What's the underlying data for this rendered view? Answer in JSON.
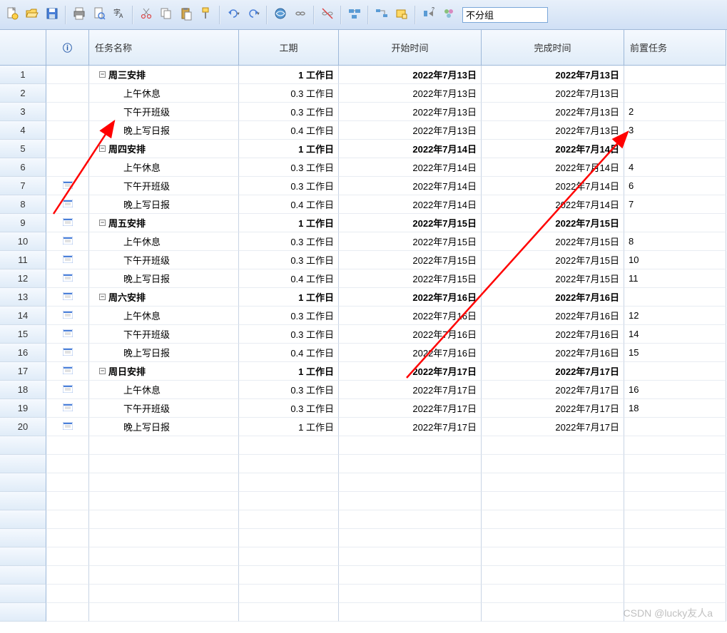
{
  "toolbar": {
    "group_input": "不分组",
    "icons": [
      "new-file-icon",
      "open-icon",
      "save-icon",
      "sep",
      "print-icon",
      "print-preview-icon",
      "spell-icon",
      "sep",
      "cut-icon",
      "copy-icon",
      "paste-icon",
      "format-painter-icon",
      "sep",
      "undo-icon",
      "redo-icon",
      "sep",
      "link-icon",
      "unlink-icon",
      "sep",
      "split-icon",
      "sep",
      "info-icon",
      "sep",
      "goto-icon",
      "note-icon",
      "sep",
      "zoom-icon",
      "group-icon"
    ]
  },
  "columns": {
    "info_header": "ⓘ",
    "name": "任务名称",
    "duration": "工期",
    "start": "开始时间",
    "finish": "完成时间",
    "predecessors": "前置任务"
  },
  "rows": [
    {
      "num": "1",
      "info": "",
      "level": 0,
      "summary": true,
      "name": "周三安排",
      "duration": "1 工作日",
      "start": "2022年7月13日",
      "finish": "2022年7月13日",
      "pred": ""
    },
    {
      "num": "2",
      "info": "",
      "level": 1,
      "summary": false,
      "name": "上午休息",
      "duration": "0.3 工作日",
      "start": "2022年7月13日",
      "finish": "2022年7月13日",
      "pred": ""
    },
    {
      "num": "3",
      "info": "",
      "level": 1,
      "summary": false,
      "name": "下午开班级",
      "duration": "0.3 工作日",
      "start": "2022年7月13日",
      "finish": "2022年7月13日",
      "pred": "2"
    },
    {
      "num": "4",
      "info": "",
      "level": 1,
      "summary": false,
      "name": "晚上写日报",
      "duration": "0.4 工作日",
      "start": "2022年7月13日",
      "finish": "2022年7月13日",
      "pred": "3"
    },
    {
      "num": "5",
      "info": "",
      "level": 0,
      "summary": true,
      "name": "周四安排",
      "duration": "1 工作日",
      "start": "2022年7月14日",
      "finish": "2022年7月14日",
      "pred": ""
    },
    {
      "num": "6",
      "info": "",
      "level": 1,
      "summary": false,
      "name": "上午休息",
      "duration": "0.3 工作日",
      "start": "2022年7月14日",
      "finish": "2022年7月14日",
      "pred": "4"
    },
    {
      "num": "7",
      "info": "recur",
      "level": 1,
      "summary": false,
      "name": "下午开班级",
      "duration": "0.3 工作日",
      "start": "2022年7月14日",
      "finish": "2022年7月14日",
      "pred": "6"
    },
    {
      "num": "8",
      "info": "recur",
      "level": 1,
      "summary": false,
      "name": "晚上写日报",
      "duration": "0.4 工作日",
      "start": "2022年7月14日",
      "finish": "2022年7月14日",
      "pred": "7"
    },
    {
      "num": "9",
      "info": "recur",
      "level": 0,
      "summary": true,
      "name": "周五安排",
      "duration": "1 工作日",
      "start": "2022年7月15日",
      "finish": "2022年7月15日",
      "pred": ""
    },
    {
      "num": "10",
      "info": "recur",
      "level": 1,
      "summary": false,
      "name": "上午休息",
      "duration": "0.3 工作日",
      "start": "2022年7月15日",
      "finish": "2022年7月15日",
      "pred": "8"
    },
    {
      "num": "11",
      "info": "recur",
      "level": 1,
      "summary": false,
      "name": "下午开班级",
      "duration": "0.3 工作日",
      "start": "2022年7月15日",
      "finish": "2022年7月15日",
      "pred": "10"
    },
    {
      "num": "12",
      "info": "recur",
      "level": 1,
      "summary": false,
      "name": "晚上写日报",
      "duration": "0.4 工作日",
      "start": "2022年7月15日",
      "finish": "2022年7月15日",
      "pred": "11"
    },
    {
      "num": "13",
      "info": "recur",
      "level": 0,
      "summary": true,
      "name": "周六安排",
      "duration": "1 工作日",
      "start": "2022年7月16日",
      "finish": "2022年7月16日",
      "pred": ""
    },
    {
      "num": "14",
      "info": "recur",
      "level": 1,
      "summary": false,
      "name": "上午休息",
      "duration": "0.3 工作日",
      "start": "2022年7月16日",
      "finish": "2022年7月16日",
      "pred": "12"
    },
    {
      "num": "15",
      "info": "recur",
      "level": 1,
      "summary": false,
      "name": "下午开班级",
      "duration": "0.3 工作日",
      "start": "2022年7月16日",
      "finish": "2022年7月16日",
      "pred": "14"
    },
    {
      "num": "16",
      "info": "recur",
      "level": 1,
      "summary": false,
      "name": "晚上写日报",
      "duration": "0.4 工作日",
      "start": "2022年7月16日",
      "finish": "2022年7月16日",
      "pred": "15"
    },
    {
      "num": "17",
      "info": "recur",
      "level": 0,
      "summary": true,
      "name": "周日安排",
      "duration": "1 工作日",
      "start": "2022年7月17日",
      "finish": "2022年7月17日",
      "pred": ""
    },
    {
      "num": "18",
      "info": "recur",
      "level": 1,
      "summary": false,
      "name": "上午休息",
      "duration": "0.3 工作日",
      "start": "2022年7月17日",
      "finish": "2022年7月17日",
      "pred": "16"
    },
    {
      "num": "19",
      "info": "recur",
      "level": 1,
      "summary": false,
      "name": "下午开班级",
      "duration": "0.3 工作日",
      "start": "2022年7月17日",
      "finish": "2022年7月17日",
      "pred": "18"
    },
    {
      "num": "20",
      "info": "recur",
      "level": 1,
      "summary": false,
      "name": "晚上写日报",
      "duration": "1 工作日",
      "start": "2022年7月17日",
      "finish": "2022年7月17日",
      "pred": ""
    }
  ],
  "empty_rows": 10,
  "watermark": "CSDN @lucky友人a",
  "colors": {
    "header_bg_top": "#f5f9fe",
    "header_bg_bottom": "#e0ecf8",
    "border": "#9db8d9",
    "annotation": "#ff0000"
  }
}
